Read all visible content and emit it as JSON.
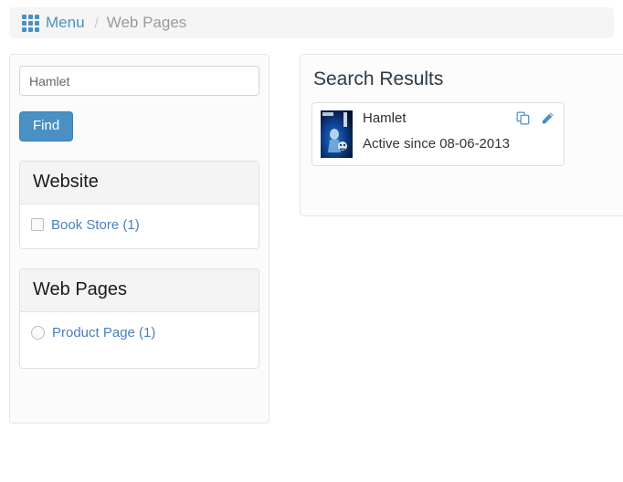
{
  "breadcrumb": {
    "menu_icon": "grid-menu-icon",
    "menu_label": "Menu",
    "separator": "/",
    "current": "Web Pages"
  },
  "sidebar": {
    "search": {
      "value": "Hamlet",
      "placeholder": "Hamlet"
    },
    "find_button": "Find",
    "facets": [
      {
        "title": "Website",
        "control": "checkbox",
        "options": [
          {
            "label": "Book Store (1)",
            "checked": false
          }
        ]
      },
      {
        "title": "Web Pages",
        "control": "radio",
        "options": [
          {
            "label": "Product Page (1)",
            "checked": false
          }
        ]
      }
    ]
  },
  "results": {
    "title": "Search Results",
    "items": [
      {
        "title": "Hamlet",
        "status": "Active since 08-06-2013",
        "thumbnail_alt": "hamlet-book-cover",
        "actions": [
          {
            "name": "duplicate-icon",
            "label": "Duplicate"
          },
          {
            "name": "edit-icon",
            "label": "Edit"
          }
        ]
      }
    ]
  },
  "colors": {
    "accent": "#4a90c4",
    "link": "#4a7fc0",
    "bar_bg": "#f5f5f5",
    "panel_head_bg": "#f4f4f4"
  }
}
